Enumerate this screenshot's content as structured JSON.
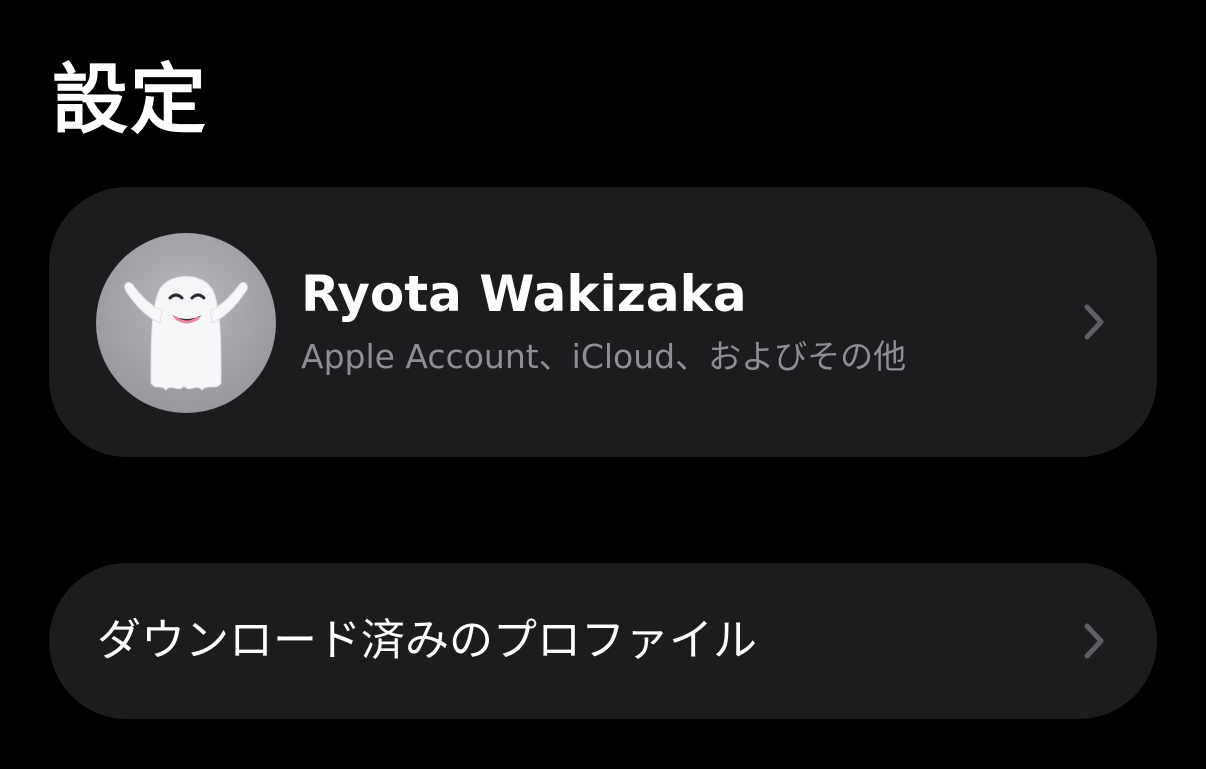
{
  "header": {
    "title": "設定"
  },
  "account": {
    "avatar_icon": "ghost-memoji-avatar",
    "name": "Ryota Wakizaka",
    "subtitle": "Apple Account、iCloud、およびその他",
    "chevron_icon": "chevron-right-icon"
  },
  "downloaded_profile": {
    "label": "ダウンロード済みのプロファイル",
    "chevron_icon": "chevron-right-icon"
  },
  "colors": {
    "background": "#000000",
    "card": "#1c1c1e",
    "primary_text": "#ffffff",
    "secondary_text": "#8e8e93",
    "chevron": "#5e5e63"
  }
}
